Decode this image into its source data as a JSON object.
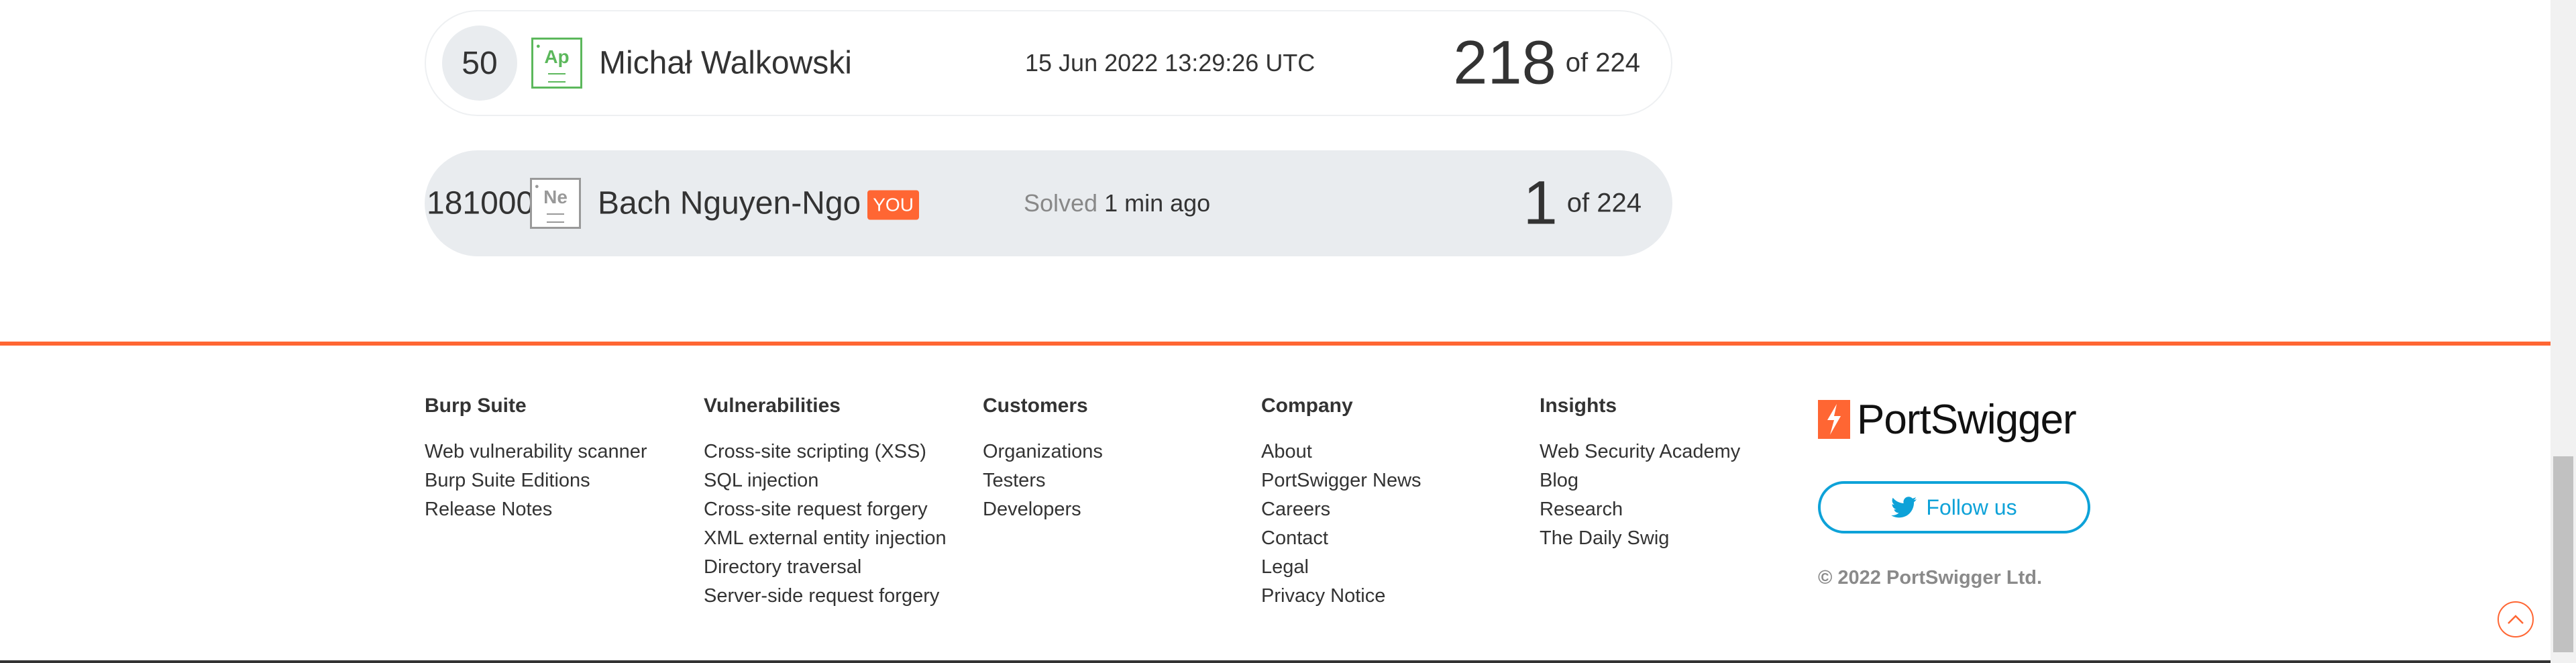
{
  "leaderboard": {
    "rows": [
      {
        "rank": "50",
        "element": "Ap",
        "name": "Michał Walkowski",
        "solved_at": "15 Jun 2022 13:29:26 UTC",
        "solved": "218",
        "of_total": "of 224"
      },
      {
        "rank": "181000",
        "element": "Ne",
        "name": "Bach Nguyen-Ngo",
        "badge": "YOU",
        "solved_label": "Solved",
        "solved_time": "1 min ago",
        "solved": "1",
        "of_total": "of 224"
      }
    ]
  },
  "footer": {
    "accent_color": "#ff6633",
    "columns": [
      {
        "heading": "Burp Suite",
        "links": [
          "Web vulnerability scanner",
          "Burp Suite Editions",
          "Release Notes"
        ]
      },
      {
        "heading": "Vulnerabilities",
        "links": [
          "Cross-site scripting (XSS)",
          "SQL injection",
          "Cross-site request forgery",
          "XML external entity injection",
          "Directory traversal",
          "Server-side request forgery"
        ]
      },
      {
        "heading": "Customers",
        "links": [
          "Organizations",
          "Testers",
          "Developers"
        ]
      },
      {
        "heading": "Company",
        "links": [
          "About",
          "PortSwigger News",
          "Careers",
          "Contact",
          "Legal",
          "Privacy Notice"
        ]
      },
      {
        "heading": "Insights",
        "links": [
          "Web Security Academy",
          "Blog",
          "Research",
          "The Daily Swig"
        ]
      }
    ],
    "brand": "PortSwigger",
    "follow_label": "Follow us",
    "follow_icon": "twitter-icon",
    "copyright": "© 2022 PortSwigger Ltd."
  },
  "scroll_top_icon": "chevron-up-icon"
}
